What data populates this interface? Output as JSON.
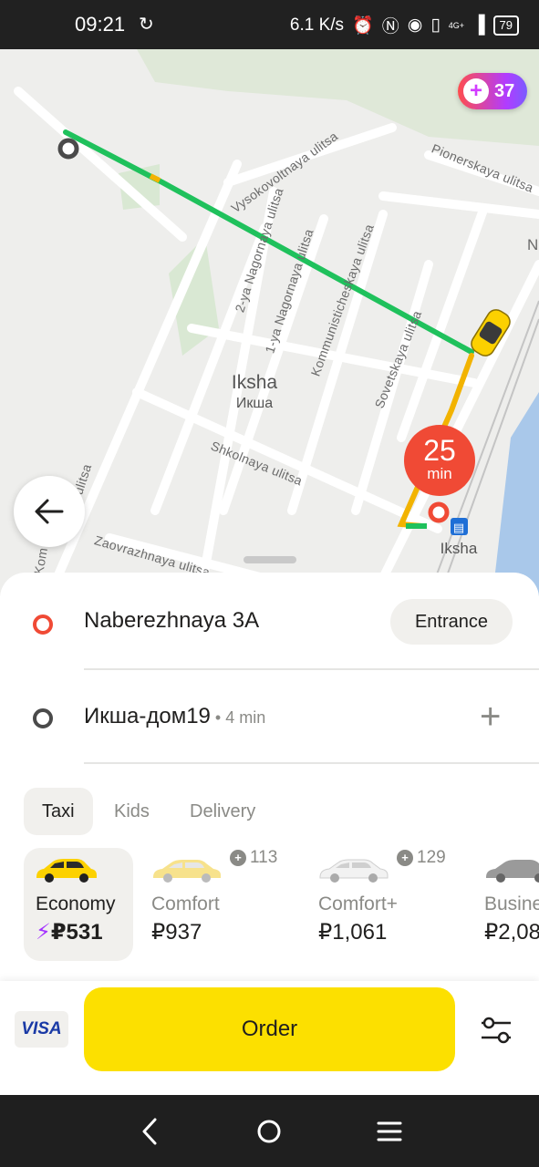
{
  "status_bar": {
    "time": "09:21",
    "speed": "6.1 K/s",
    "network": "4G+",
    "battery": "79"
  },
  "map": {
    "plus_points": "37",
    "eta_value": "25",
    "eta_unit": "min",
    "town_latin": "Iksha",
    "town_cyrillic": "Икша",
    "station": "Iksha",
    "streets": [
      "Vysokovoltnaya ulitsa",
      "Pionerskaya ulitsa",
      "2-ya Nagornaya ulitsa",
      "1-ya Nagornaya ulitsa",
      "Kommunisticheskaya ulitsa",
      "Sovetskaya ulitsa",
      "Shkolnaya ulitsa",
      "Zaovrazhnaya ulitsa",
      "ulitsa",
      "Kom",
      "N"
    ]
  },
  "route": {
    "pickup": "Naberezhnaya 3A",
    "entrance_button": "Entrance",
    "destination": "Икша-дом19",
    "destination_eta": "4 min"
  },
  "tabs": [
    "Taxi",
    "Kids",
    "Delivery"
  ],
  "tariffs": [
    {
      "name": "Economy",
      "price": "₽531",
      "selected": true,
      "points": ""
    },
    {
      "name": "Comfort",
      "price": "₽937",
      "selected": false,
      "points": "113"
    },
    {
      "name": "Comfort+",
      "price": "₽1,061",
      "selected": false,
      "points": "129"
    },
    {
      "name": "Busine",
      "price": "₽2,08",
      "selected": false,
      "points": ""
    }
  ],
  "payment": "VISA",
  "order_button": "Order",
  "colors": {
    "accent_yellow": "#fce000",
    "route_green": "#1fc15c",
    "eta_red": "#f04a35"
  }
}
